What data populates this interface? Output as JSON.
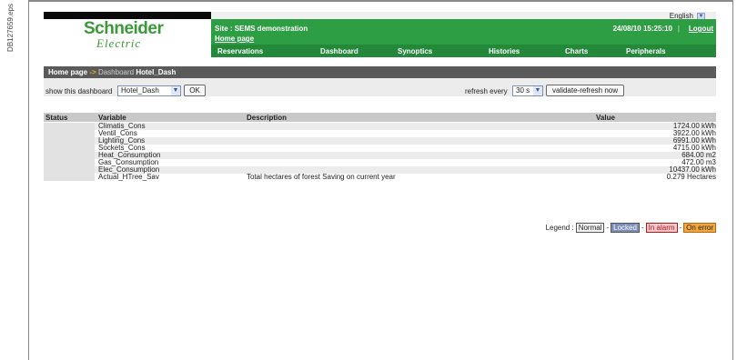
{
  "doc_ref": "DB127659.eps",
  "header": {
    "language": "English",
    "logo_line1": "Schneider",
    "logo_line2": "Electric",
    "site": "Site : SEMS demonstration",
    "home_link": "Home page",
    "datetime": "24/08/10 15:25:10",
    "separator": "|",
    "logout": "Logout",
    "nav": [
      "Reservations",
      "Dashboard",
      "Synoptics",
      "Histories",
      "Charts",
      "Peripherals"
    ]
  },
  "breadcrumb": {
    "home": "Home page",
    "arrow": "->",
    "section": "Dashboard",
    "current": "Hotel_Dash"
  },
  "controls": {
    "show_label": "show this dashboard",
    "dashboard_value": "Hotel_Dash",
    "ok_label": "OK",
    "refresh_label": "refresh every",
    "refresh_value": "30 s",
    "validate_label": "validate-refresh now"
  },
  "table": {
    "columns": [
      "Status",
      "Variable",
      "Description",
      "Value"
    ],
    "rows": [
      {
        "variable": "Climatis_Cons",
        "description": "",
        "value": "1724.00 kWh"
      },
      {
        "variable": "Ventil_Cons",
        "description": "",
        "value": "3922.00 kWh"
      },
      {
        "variable": "Lighting_Cons",
        "description": "",
        "value": "6991.00 kWh"
      },
      {
        "variable": "Sockets_Cons",
        "description": "",
        "value": "4715.00 kWh"
      },
      {
        "variable": "Heat_Consumption",
        "description": "",
        "value": "684.00 m2"
      },
      {
        "variable": "Gas_Consumption",
        "description": "",
        "value": "472.00 m3"
      },
      {
        "variable": "Elec_Consumption",
        "description": "",
        "value": "10437.00 kWh"
      },
      {
        "variable": "Actual_HTree_Sav",
        "description": "Total hectares of forest Saving on current year",
        "value": "0.279 Hectares"
      }
    ]
  },
  "legend": {
    "label": "Legend :",
    "dash": "-",
    "normal": "Normal",
    "locked": "Locked",
    "alarm": "In alarm",
    "error": "On error"
  }
}
